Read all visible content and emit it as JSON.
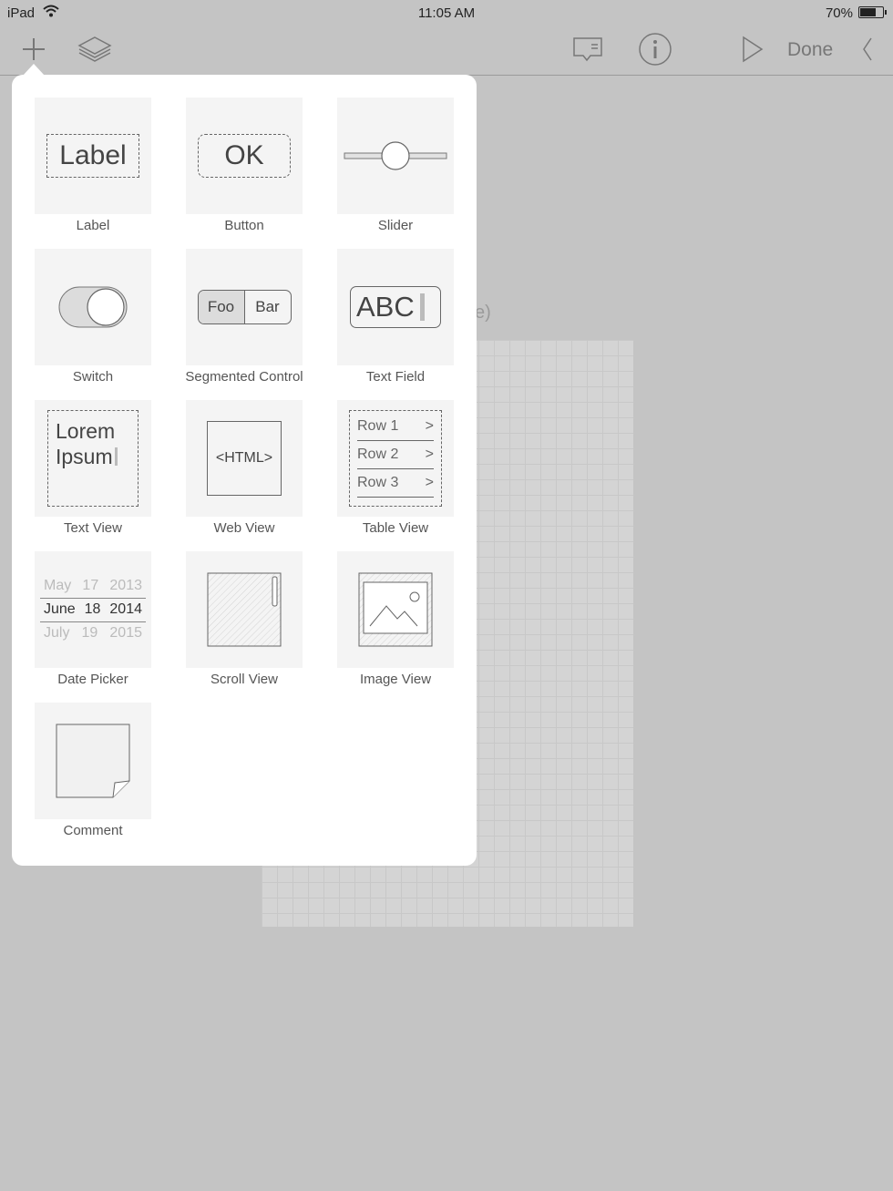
{
  "status_bar": {
    "device": "iPad",
    "time": "11:05 AM",
    "battery": "70%"
  },
  "toolbar": {
    "done_label": "Done"
  },
  "canvas": {
    "partial_label": "e)"
  },
  "library": {
    "items": [
      {
        "caption": "Label",
        "preview": "Label"
      },
      {
        "caption": "Button",
        "preview": "OK"
      },
      {
        "caption": "Slider"
      },
      {
        "caption": "Switch"
      },
      {
        "caption": "Segmented Control",
        "segments": [
          "Foo",
          "Bar"
        ]
      },
      {
        "caption": "Text Field",
        "preview": "ABC"
      },
      {
        "caption": "Text View",
        "lines": [
          "Lorem",
          "Ipsum"
        ]
      },
      {
        "caption": "Web View",
        "preview": "<HTML>"
      },
      {
        "caption": "Table View",
        "rows": [
          "Row 1",
          "Row 2",
          "Row 3"
        ]
      },
      {
        "caption": "Date Picker",
        "rows": [
          [
            "May",
            "17",
            "2013"
          ],
          [
            "June",
            "18",
            "2014"
          ],
          [
            "July",
            "19",
            "2015"
          ]
        ]
      },
      {
        "caption": "Scroll View"
      },
      {
        "caption": "Image View"
      },
      {
        "caption": "Comment"
      }
    ]
  }
}
